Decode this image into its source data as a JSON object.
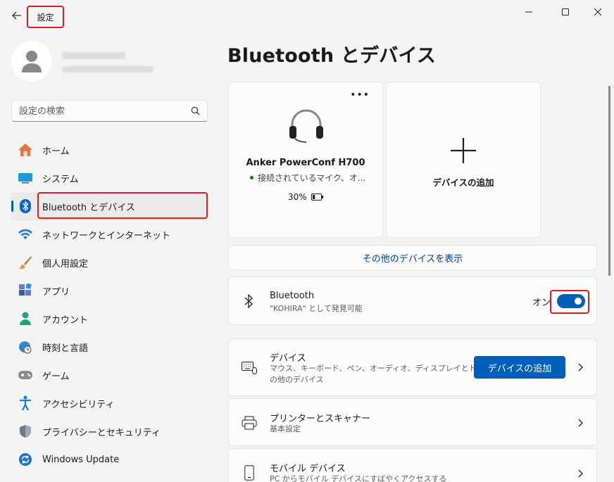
{
  "window": {
    "title": "設定"
  },
  "search": {
    "placeholder": "設定の検索"
  },
  "nav": {
    "items": [
      {
        "label": "ホーム"
      },
      {
        "label": "システム"
      },
      {
        "label": "Bluetooth とデバイス"
      },
      {
        "label": "ネットワークとインターネット"
      },
      {
        "label": "個人用設定"
      },
      {
        "label": "アプリ"
      },
      {
        "label": "アカウント"
      },
      {
        "label": "時刻と言語"
      },
      {
        "label": "ゲーム"
      },
      {
        "label": "アクセシビリティ"
      },
      {
        "label": "プライバシーとセキュリティ"
      },
      {
        "label": "Windows Update"
      }
    ]
  },
  "page": {
    "title": "Bluetooth とデバイス"
  },
  "device_card": {
    "name": "Anker PowerConf H700",
    "status": "接続されているマイク、オ...",
    "battery": "30%",
    "battery_level": 0.3
  },
  "add_card": {
    "label": "デバイスの追加"
  },
  "show_more": {
    "label": "その他のデバイスを表示"
  },
  "bluetooth_row": {
    "title": "Bluetooth",
    "subtitle": "\"KOHIRA\" として発見可能",
    "state_label": "オン",
    "enabled": true
  },
  "devices_row": {
    "title": "デバイス",
    "subtitle_line1": "マウス、キーボード、ペン、オーディオ、ディスプレイとドック、そ",
    "subtitle_line2": "の他のデバイス",
    "button_label": "デバイスの追加"
  },
  "printers_row": {
    "title": "プリンターとスキャナー",
    "subtitle": "基本設定"
  },
  "mobile_row": {
    "title": "モバイル デバイス",
    "subtitle": "PC からモバイル デバイスにすばやくアクセスする"
  },
  "colors": {
    "accent": "#005fb8",
    "highlight": "#e01b1b",
    "background": "#f3f3f3",
    "card": "#fbfbfb"
  }
}
